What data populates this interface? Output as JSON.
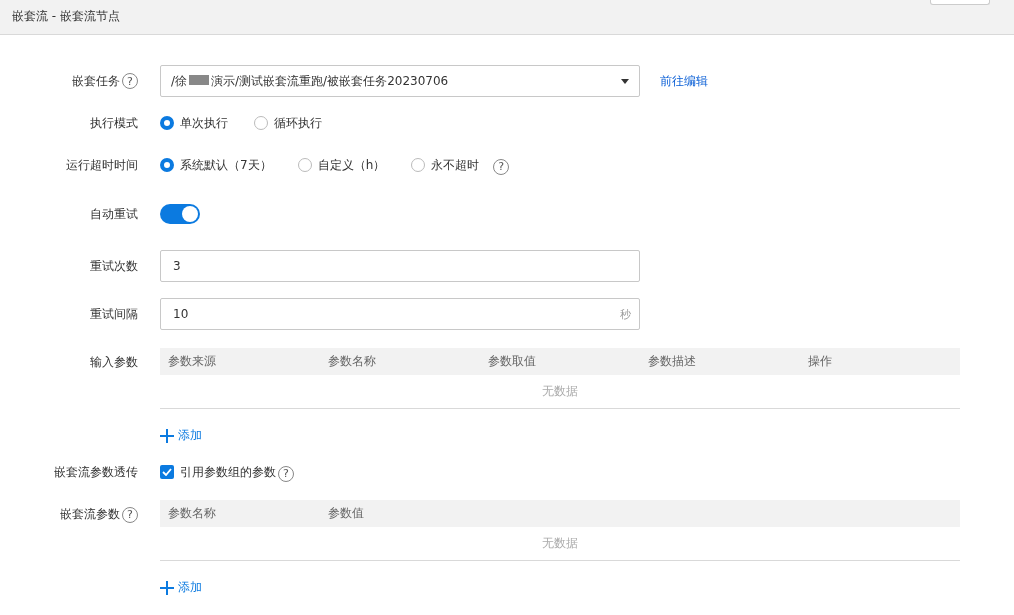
{
  "header": {
    "title": "嵌套流 - 嵌套流节点"
  },
  "nested_task": {
    "label": "嵌套任务",
    "help": "?",
    "value_start": "/徐",
    "value_end": "演示/测试嵌套流重跑/被嵌套任务20230706",
    "link": "前往编辑"
  },
  "exec_mode": {
    "label": "执行模式",
    "options": [
      {
        "label": "单次执行",
        "selected": true
      },
      {
        "label": "循环执行",
        "selected": false
      }
    ]
  },
  "timeout": {
    "label": "运行超时时间",
    "options": [
      {
        "label": "系统默认（7天）",
        "selected": true
      },
      {
        "label": "自定义（h）",
        "selected": false
      },
      {
        "label": "永不超时",
        "selected": false
      }
    ],
    "help": "?"
  },
  "auto_retry": {
    "label": "自动重试",
    "on": true
  },
  "retry_count": {
    "label": "重试次数",
    "value": "3"
  },
  "retry_interval": {
    "label": "重试间隔",
    "value": "10",
    "unit": "秒"
  },
  "input_params": {
    "label": "输入参数",
    "columns": [
      "参数来源",
      "参数名称",
      "参数取值",
      "参数描述",
      "操作"
    ],
    "empty": "无数据",
    "add": "添加"
  },
  "pass_through": {
    "label": "嵌套流参数透传",
    "checkbox": "引用参数组的参数",
    "checked": true,
    "help": "?"
  },
  "flow_params": {
    "label": "嵌套流参数",
    "help": "?",
    "columns": [
      "参数名称",
      "参数值"
    ],
    "empty": "无数据",
    "add": "添加"
  }
}
